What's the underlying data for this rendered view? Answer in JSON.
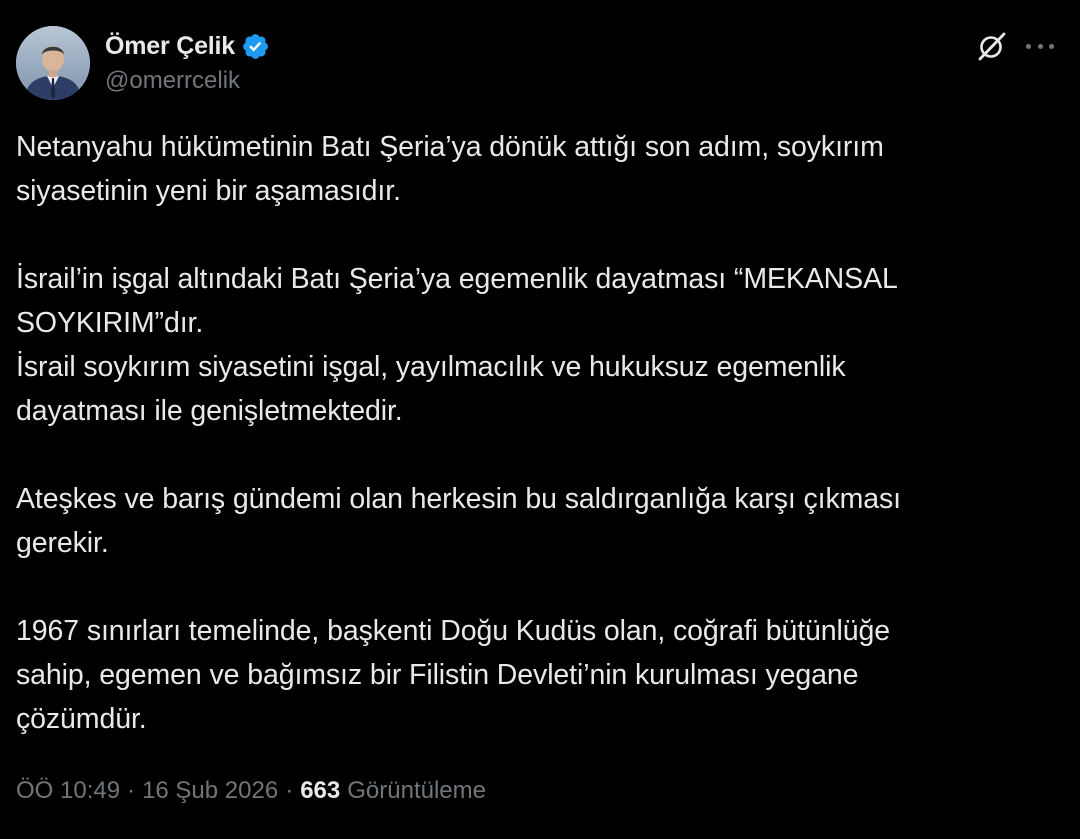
{
  "author": {
    "name": "Ömer Çelik",
    "handle": "@omerrcelik",
    "verified": true
  },
  "icons": {
    "verified_badge": "verified-badge-icon",
    "grok": "grok-icon",
    "more": "more-options-icon"
  },
  "colors": {
    "background": "#000000",
    "text": "#e7e9ea",
    "muted": "#71767b",
    "verified": "#1d9bf0"
  },
  "tweet": {
    "paragraphs": [
      [
        "Netanyahu hükümetinin Batı Şeria’ya dönük attığı son adım, soykırım",
        "siyasetinin yeni bir aşamasıdır."
      ],
      [
        "İsrail’in işgal altındaki Batı Şeria’ya egemenlik dayatması “MEKANSAL",
        "SOYKIRIM”dır.",
        "İsrail soykırım siyasetini işgal, yayılmacılık ve hukuksuz egemenlik",
        "dayatması ile genişletmektedir."
      ],
      [
        "Ateşkes ve barış gündemi olan herkesin bu saldırganlığa karşı çıkması",
        "gerekir."
      ],
      [
        "1967 sınırları temelinde, başkenti Doğu Kudüs olan, coğrafi bütünlüğe",
        "sahip, egemen ve bağımsız bir Filistin Devleti’nin kurulması yegane",
        "çözümdür."
      ]
    ]
  },
  "meta": {
    "time": "ÖÖ 10:49",
    "separator": "·",
    "date": "16 Şub 2026",
    "views_count": "663",
    "views_label": "Görüntüleme"
  }
}
